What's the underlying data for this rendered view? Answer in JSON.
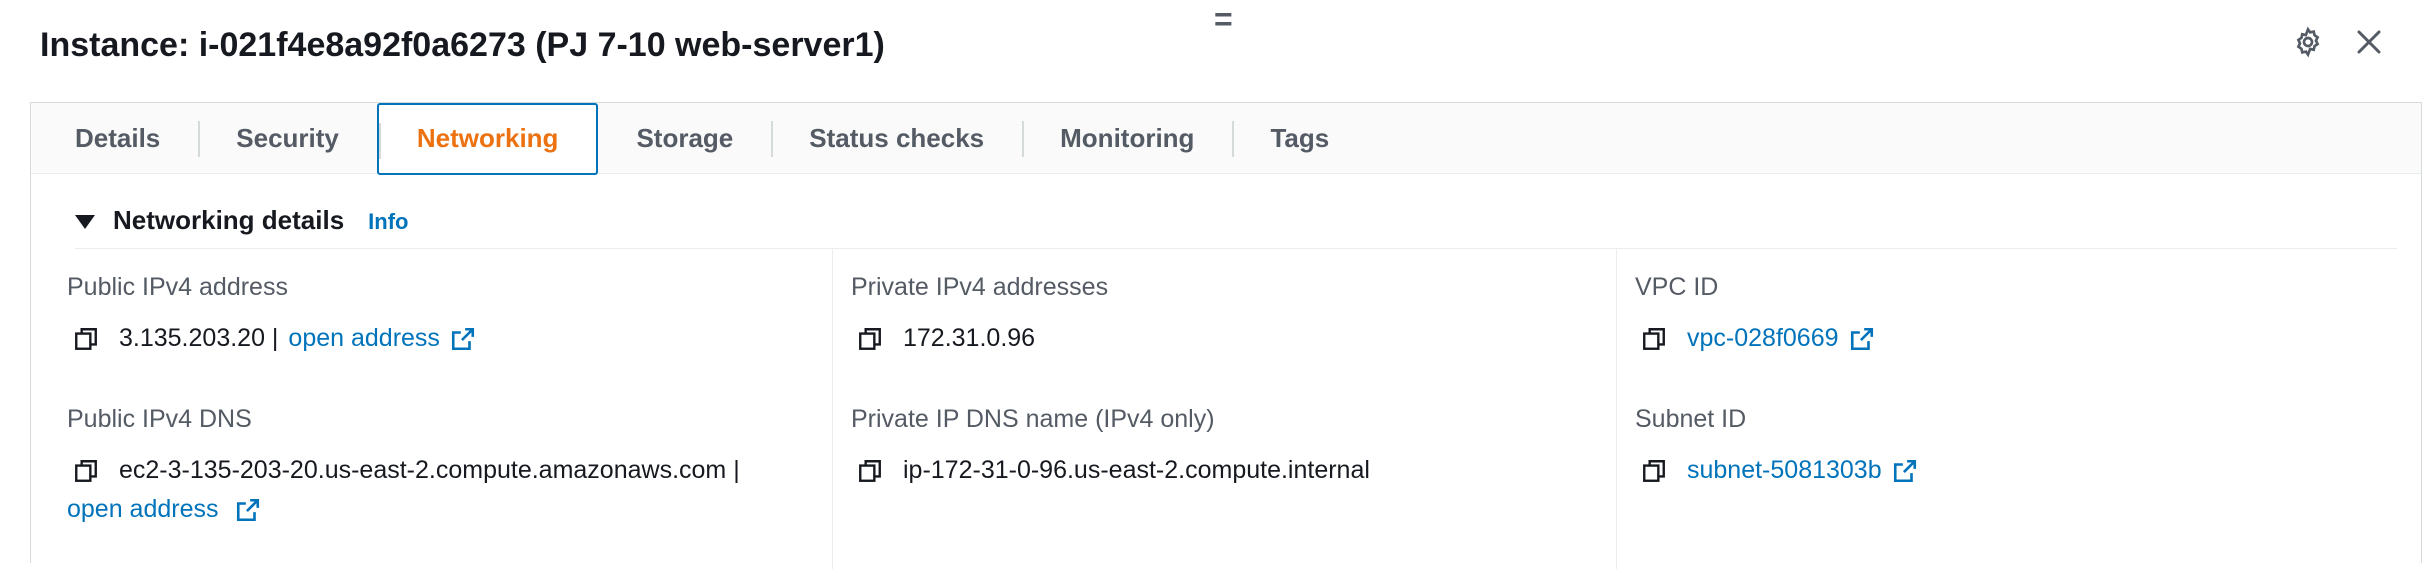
{
  "header": {
    "title": "Instance: i-021f4e8a92f0a6273 (PJ 7-10 web-server1)",
    "drag_handle": "="
  },
  "tabs": [
    {
      "label": "Details",
      "active": false
    },
    {
      "label": "Security",
      "active": false
    },
    {
      "label": "Networking",
      "active": true
    },
    {
      "label": "Storage",
      "active": false
    },
    {
      "label": "Status checks",
      "active": false
    },
    {
      "label": "Monitoring",
      "active": false
    },
    {
      "label": "Tags",
      "active": false
    }
  ],
  "section": {
    "title": "Networking details",
    "info_label": "Info"
  },
  "fields": {
    "public_ipv4": {
      "label": "Public IPv4 address",
      "value": "3.135.203.20 |",
      "link": "open address"
    },
    "private_ipv4": {
      "label": "Private IPv4 addresses",
      "value": "172.31.0.96"
    },
    "vpc": {
      "label": "VPC ID",
      "link": "vpc-028f0669"
    },
    "public_dns": {
      "label": "Public IPv4 DNS",
      "value": "ec2-3-135-203-20.us-east-2.compute.amazonaws.com |",
      "link": "open address"
    },
    "private_dns": {
      "label": "Private IP DNS name (IPv4 only)",
      "value": "ip-172-31-0-96.us-east-2.compute.internal"
    },
    "subnet": {
      "label": "Subnet ID",
      "link": "subnet-5081303b"
    }
  },
  "colors": {
    "accent_tab": "#ec7211",
    "link": "#0073bb",
    "active_border": "#0073bb"
  },
  "icons": [
    "settings-gear-icon",
    "close-icon",
    "copy-icon",
    "external-link-icon",
    "caret-down-icon"
  ]
}
